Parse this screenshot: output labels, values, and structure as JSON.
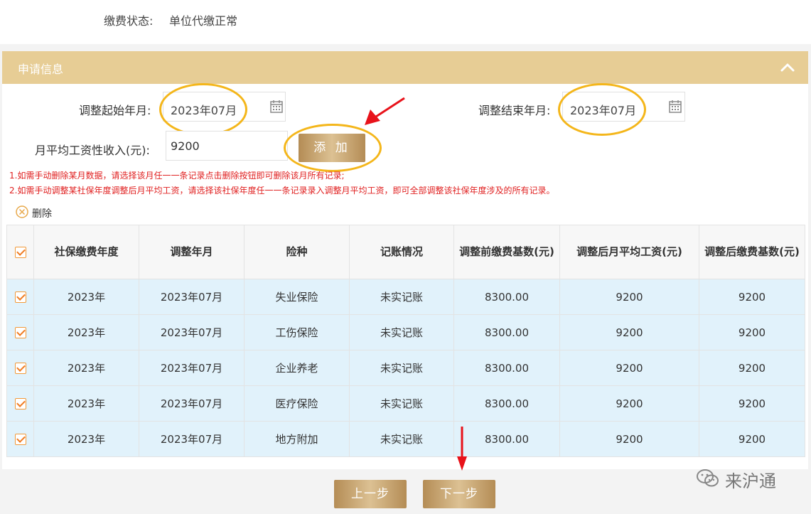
{
  "payment_status": {
    "label": "缴费状态:",
    "value": "单位代缴正常"
  },
  "panel": {
    "title": "申请信息"
  },
  "form": {
    "start_label": "调整起始年月:",
    "start_value": "2023年07月",
    "end_label": "调整结束年月:",
    "end_value": "2023年07月",
    "salary_label": "月平均工资性收入(元):",
    "salary_value": "9200",
    "add_label": "添 加"
  },
  "notes": [
    "1.如需手动删除某月数据，请选择该月任一一条记录点击删除按钮即可删除该月所有记录;",
    "2.如需手动调整某社保年度调整后月平均工资，请选择该社保年度任一一条记录录入调整月平均工资，即可全部调整该社保年度涉及的所有记录。"
  ],
  "delete_label": "删除",
  "table": {
    "headers": [
      "社保缴费年度",
      "调整年月",
      "险种",
      "记账情况",
      "调整前缴费基数(元)",
      "调整后月平均工资(元)",
      "调整后缴费基数(元)"
    ],
    "rows": [
      [
        "2023年",
        "2023年07月",
        "失业保险",
        "未实记账",
        "8300.00",
        "9200",
        "9200"
      ],
      [
        "2023年",
        "2023年07月",
        "工伤保险",
        "未实记账",
        "8300.00",
        "9200",
        "9200"
      ],
      [
        "2023年",
        "2023年07月",
        "企业养老",
        "未实记账",
        "8300.00",
        "9200",
        "9200"
      ],
      [
        "2023年",
        "2023年07月",
        "医疗保险",
        "未实记账",
        "8300.00",
        "9200",
        "9200"
      ],
      [
        "2023年",
        "2023年07月",
        "地方附加",
        "未实记账",
        "8300.00",
        "9200",
        "9200"
      ]
    ]
  },
  "nav": {
    "prev_label": "上一步",
    "next_label": "下一步"
  },
  "watermark": {
    "text": "来沪通"
  },
  "colors": {
    "header_gold": "#e7cd95",
    "highlight": "#f4b61a",
    "note_red": "#e02020",
    "row_bg": "#e1f2fb",
    "arrow_red": "#e8121a"
  }
}
